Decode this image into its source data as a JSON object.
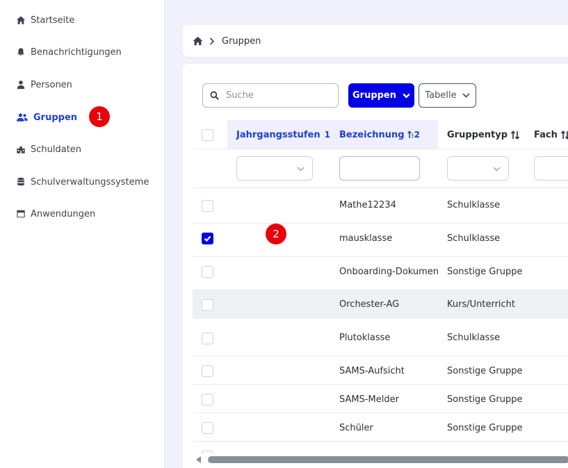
{
  "sidebar": {
    "items": [
      {
        "label": "Startseite",
        "icon": "home-icon"
      },
      {
        "label": "Benachrichtigungen",
        "icon": "bell-icon"
      },
      {
        "label": "Personen",
        "icon": "person-icon"
      },
      {
        "label": "Gruppen",
        "icon": "users-icon",
        "active": true
      },
      {
        "label": "Schuldaten",
        "icon": "school-icon"
      },
      {
        "label": "Schulverwaltungssysteme",
        "icon": "database-icon"
      },
      {
        "label": "Anwendungen",
        "icon": "window-icon"
      }
    ]
  },
  "markers": [
    "1",
    "2"
  ],
  "breadcrumb": {
    "current": "Gruppen"
  },
  "toolbar": {
    "search_placeholder": "Suche",
    "search_value": "",
    "gruppen_button": "Gruppen",
    "view_button": "Tabelle"
  },
  "table": {
    "columns": [
      {
        "label": "Jahrgangsstufen",
        "sort": "1"
      },
      {
        "label": "Bezeichnung",
        "sort": "2"
      },
      {
        "label": "Gruppentyp",
        "sort": ""
      },
      {
        "label": "Fach",
        "sort": ""
      }
    ],
    "rows": [
      {
        "bezeichnung": "Mathe12234",
        "gruppentyp": "Schulklasse",
        "checked": false
      },
      {
        "bezeichnung": "mausklasse",
        "gruppentyp": "Schulklasse",
        "checked": true
      },
      {
        "bezeichnung": "Onboarding-Dokumente",
        "gruppentyp": "Sonstige Gruppe",
        "checked": false
      },
      {
        "bezeichnung": "Orchester-AG",
        "gruppentyp": "Kurs/Unterricht",
        "checked": false,
        "hover": true
      },
      {
        "bezeichnung": "Plutoklasse",
        "gruppentyp": "Schulklasse",
        "checked": false
      },
      {
        "bezeichnung": "SAMS-Aufsicht",
        "gruppentyp": "Sonstige Gruppe",
        "checked": false
      },
      {
        "bezeichnung": "SAMS-Melder",
        "gruppentyp": "Sonstige Gruppe",
        "checked": false
      },
      {
        "bezeichnung": "Schüler",
        "gruppentyp": "Sonstige Gruppe",
        "checked": false
      }
    ]
  },
  "colors": {
    "accent": "#0000e6",
    "active_nav": "#1f3fcf",
    "marker": "#e8000b"
  }
}
